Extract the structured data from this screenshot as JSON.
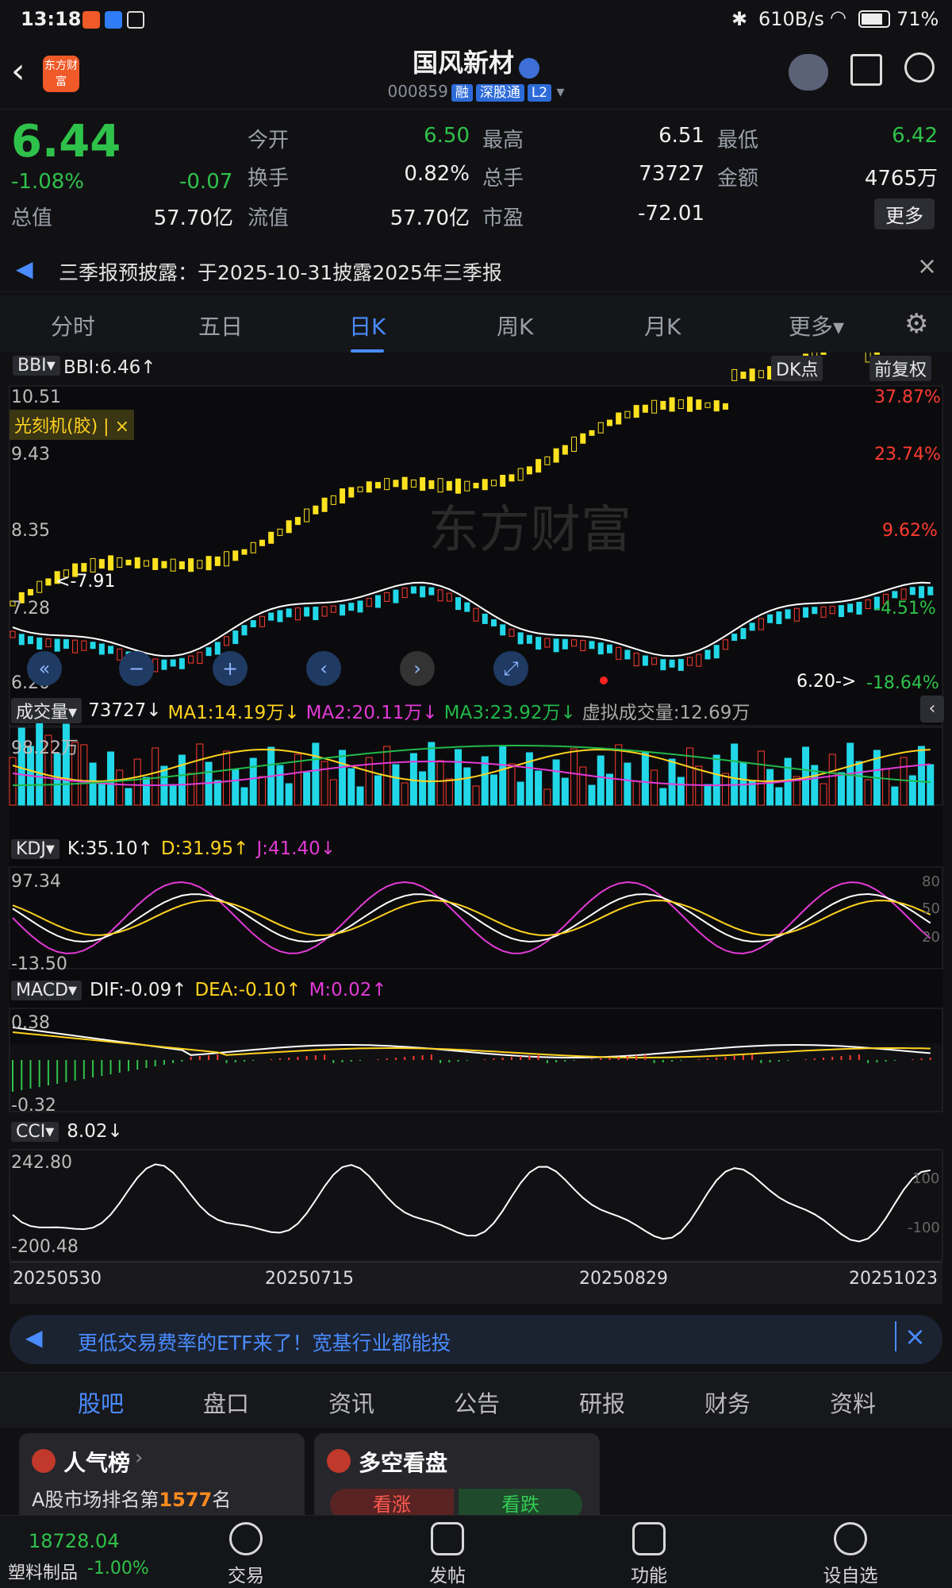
{
  "status": {
    "time": "13:18",
    "net_speed": "610B/s",
    "battery": "71%"
  },
  "header": {
    "logo_text": "东方财富",
    "stock_name": "国风新材",
    "stock_code": "000859",
    "tag_rong": "融",
    "tag_sgt": "深股通",
    "tag_l2": "L2"
  },
  "quote": {
    "price": "6.44",
    "change_pct": "-1.08%",
    "change": "-0.07",
    "open_label": "今开",
    "open": "6.50",
    "high_label": "最高",
    "high": "6.51",
    "low_label": "最低",
    "low": "6.42",
    "turnover_label": "换手",
    "turnover": "0.82%",
    "volume_label": "总手",
    "volume": "73727",
    "amount_label": "金额",
    "amount": "4765万",
    "mktcap_label": "总值",
    "mktcap": "57.70亿",
    "float_label": "流值",
    "float": "57.70亿",
    "pe_label": "市盈",
    "pe": "-72.01",
    "more_label": "更多"
  },
  "notice": {
    "text": "三季报预披露：于2025-10-31披露2025年三季报"
  },
  "tabs": [
    "分时",
    "五日",
    "日K",
    "周K",
    "月K",
    "更多"
  ],
  "kline": {
    "ind": "BBI",
    "ind_value": "BBI:6.46↑",
    "dk_label": "DK点",
    "adj_label": "前复权",
    "concept_tag": "光刻机(胶) | ×",
    "y_ticks": [
      "10.51",
      "9.43",
      "8.35",
      "7.28",
      "6.20"
    ],
    "pct_ticks": [
      "37.87%",
      "23.74%",
      "9.62%",
      "-4.51%",
      "-18.64%"
    ],
    "note_left": "<-7.91",
    "note_right": "6.20->",
    "watermark": "东方财富"
  },
  "volume": {
    "label": "成交量",
    "value": "73727↓",
    "ma1": "MA1:14.19万↓",
    "ma2": "MA2:20.11万↓",
    "ma3": "MA3:23.92万↓",
    "virtual": "虚拟成交量:12.69万",
    "top": "98.22万"
  },
  "kdj": {
    "label": "KDJ",
    "k": "K:35.10↑",
    "d": "D:31.95↑",
    "j": "J:41.40↓",
    "top": "97.34",
    "bottom": "-13.50",
    "r80": "80",
    "r50": "50",
    "r20": "20"
  },
  "macd": {
    "label": "MACD",
    "dif": "DIF:-0.09↑",
    "dea": "DEA:-0.10↑",
    "m": "M:0.02↑",
    "top": "0.38",
    "bottom": "-0.32"
  },
  "cci": {
    "label": "CCI",
    "value": "8.02↓",
    "top": "242.80",
    "bottom": "-200.48",
    "r1": "100",
    "r2": "-100"
  },
  "dates": [
    "20250530",
    "20250715",
    "20250829",
    "20251023"
  ],
  "banner": {
    "text": "更低交易费率的ETF来了！宽基行业都能投"
  },
  "bottom_tabs": [
    "股吧",
    "盘口",
    "资讯",
    "公告",
    "研报",
    "财务",
    "资料"
  ],
  "cards": {
    "rank_title": "人气榜",
    "rank_text_a": "A股市场排名第",
    "rank_num": "1577",
    "rank_text_b": "名",
    "ls_title": "多空看盘",
    "up": "看涨",
    "down": "看跌"
  },
  "footer": {
    "index_value": "18728.04",
    "index_name": "塑料制品",
    "index_change": "-1.00%",
    "trade": "交易",
    "post": "发帖",
    "func": "功能",
    "watch": "设自选"
  },
  "colors": {
    "accent": "#4a8cff",
    "up": "#ff3b30",
    "down": "#2fc24a",
    "candle_hist": "#ffe21f"
  }
}
